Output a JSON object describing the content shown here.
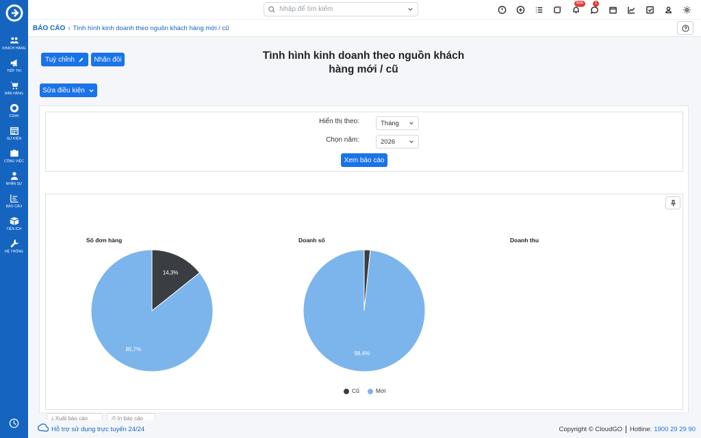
{
  "sidebar": {
    "items": [
      {
        "label": "KHÁCH HÀNG",
        "icon": "users-icon"
      },
      {
        "label": "TIẾP THỊ",
        "icon": "megaphone-icon"
      },
      {
        "label": "BÁN HÀNG",
        "icon": "cart-icon"
      },
      {
        "label": "CSKH",
        "icon": "lifebuoy-icon"
      },
      {
        "label": "SỰ KIỆN",
        "icon": "calendar-icon"
      },
      {
        "label": "CÔNG VIỆC",
        "icon": "briefcase-icon"
      },
      {
        "label": "NHÂN SỰ",
        "icon": "person-icon"
      },
      {
        "label": "BÁO CÁO",
        "icon": "report-icon"
      },
      {
        "label": "TIỆN ÍCH",
        "icon": "box-icon"
      },
      {
        "label": "HỆ THỐNG",
        "icon": "wrench-icon"
      }
    ]
  },
  "topbar": {
    "search_placeholder": "Nhập để tìm kiếm",
    "notifications_badge": "696",
    "messages_badge": "1"
  },
  "breadcrumb": {
    "root": "BÁO CÁO",
    "current": "Tình hình kinh doanh theo nguồn khách hàng mới / cũ"
  },
  "actions": {
    "customize": "Tuỳ chỉnh",
    "duplicate": "Nhân đôi",
    "edit_conditions": "Sửa điều kiện"
  },
  "page_title": "Tình hình kinh doanh theo nguồn khách hàng mới / cũ",
  "filters": {
    "display_label": "Hiển thị theo:",
    "display_value": "Tháng",
    "year_label": "Chọn năm:",
    "year_value": "2026",
    "view_button": "Xem báo cáo"
  },
  "chart_data": [
    {
      "type": "pie",
      "title": "Số đơn hàng",
      "categories": [
        "Cũ",
        "Mới"
      ],
      "values": [
        14.3,
        85.7
      ],
      "labels": [
        "14,3%",
        "85,7%"
      ],
      "colors": [
        "#3a3d42",
        "#7cb5ec"
      ]
    },
    {
      "type": "pie",
      "title": "Doanh số",
      "categories": [
        "Cũ",
        "Mới"
      ],
      "values": [
        1.6,
        98.4
      ],
      "labels": [
        "",
        "98,4%"
      ],
      "colors": [
        "#3a3d42",
        "#7cb5ec"
      ]
    },
    {
      "type": "pie",
      "title": "Doanh thu",
      "categories": [],
      "values": []
    }
  ],
  "legend": [
    {
      "name": "Cũ",
      "color": "#3a3d42"
    },
    {
      "name": "Mới",
      "color": "#7cb5ec"
    }
  ],
  "bottom_buttons": {
    "export": "Xuất báo cáo",
    "print": "In báo cáo"
  },
  "footer": {
    "support": "Hỗ trợ sử dụng trực tuyến 24/24",
    "copyright": "Copyright © CloudGO",
    "hotline_label": "Hotline:",
    "hotline": "1900 29 29 90"
  }
}
